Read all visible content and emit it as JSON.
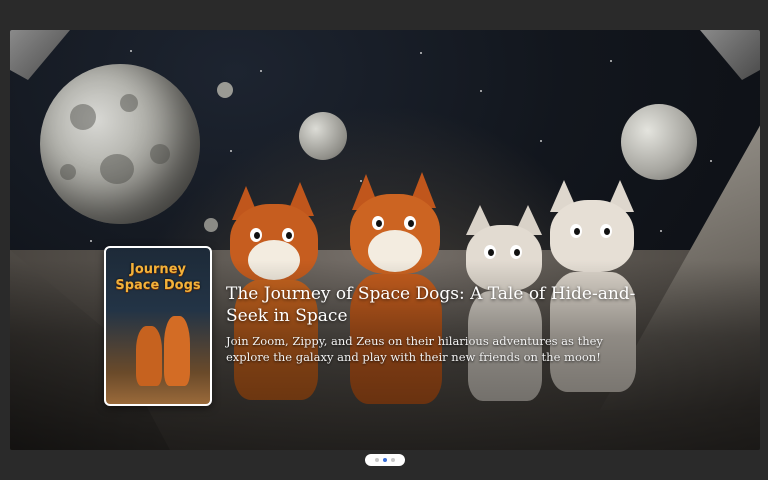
{
  "carousel": {
    "slides": [
      {
        "title": "The Journey of Space Dogs: A Tale of Hide-and-Seek in Space",
        "description": "Join Zoom, Zippy, and Zeus on their hilarious adventures as they explore the galaxy and play with their new friends on the moon!",
        "cover": {
          "title_line1": "Journey",
          "title_line2": "Space Dogs"
        }
      }
    ],
    "pager": {
      "count": 3,
      "active_index": 1
    }
  },
  "colors": {
    "page_background": "#2a2a2a",
    "title_text": "#ffffff",
    "cover_title": "#f3b23a",
    "pager_active": "#3a6fd8"
  }
}
